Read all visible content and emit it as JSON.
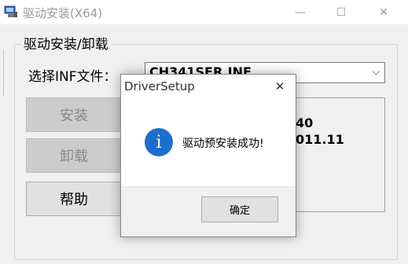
{
  "window": {
    "title": "驱动安装(X64)",
    "minimize_glyph": "—",
    "maximize_glyph": "☐",
    "close_glyph": "✕"
  },
  "group": {
    "title": "驱动安装/卸载"
  },
  "inf": {
    "label": "选择INF文件：",
    "selected": "CH341SER.INF",
    "arrow_glyph": "⌵"
  },
  "buttons": {
    "install": "安装",
    "uninstall": "卸载",
    "help": "帮助"
  },
  "info": {
    "line1": "40",
    "line2": "011.11"
  },
  "dialog": {
    "title": "DriverSetup",
    "close_glyph": "✕",
    "icon_glyph": "i",
    "message": "驱动预安装成功!",
    "ok_label": "确定"
  },
  "colors": {
    "info_icon": "#1e6fcd",
    "disabled_button": "#cccccc"
  }
}
